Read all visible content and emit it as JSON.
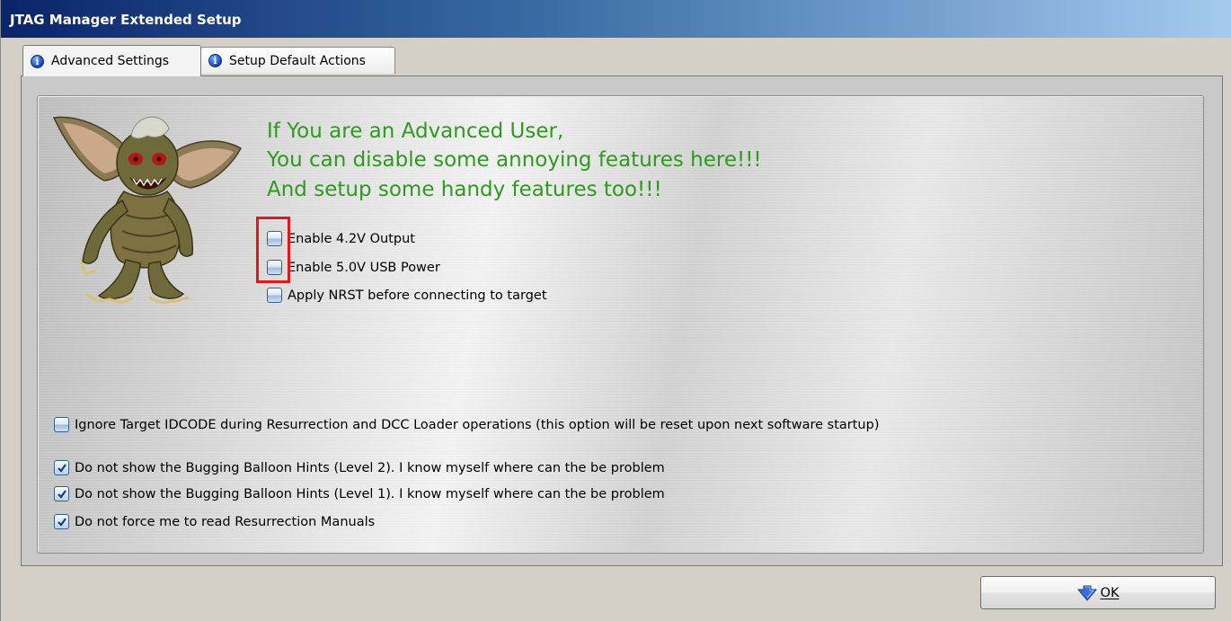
{
  "window": {
    "title": "JTAG Manager Extended Setup"
  },
  "tabs": [
    {
      "label": "Advanced Settings",
      "icon": "info-icon",
      "active": true
    },
    {
      "label": "Setup Default Actions",
      "icon": "info-icon",
      "active": false
    }
  ],
  "panel": {
    "mascot_icon": "gremlin-mascot-image",
    "headline": [
      "If You are an Advanced User,",
      "You can disable some annoying features here!!!",
      "And setup some handy features too!!!"
    ],
    "headline_color": "#2e9a1e",
    "options": [
      {
        "label": "Enable 4.2V Output",
        "checked": false
      },
      {
        "label": "Enable 5.0V USB Power",
        "checked": false
      },
      {
        "label": "Apply NRST before connecting to target",
        "checked": false
      }
    ],
    "ignore_idcode": {
      "label": "Ignore Target IDCODE during Resurrection and DCC Loader operations (this option will be reset upon next software startup)",
      "checked": false
    },
    "hint_options": [
      {
        "label": "Do not show the Bugging Balloon Hints (Level 2). I know myself where can the be problem",
        "checked": true
      },
      {
        "label": "Do not show the Bugging Balloon Hints (Level 1). I know myself where can the be problem",
        "checked": true
      },
      {
        "label": "Do not force me to read Resurrection Manuals",
        "checked": true
      }
    ],
    "highlight_color": "#e01818"
  },
  "footer": {
    "ok_label": "OK",
    "ok_icon": "down-arrow-icon"
  }
}
